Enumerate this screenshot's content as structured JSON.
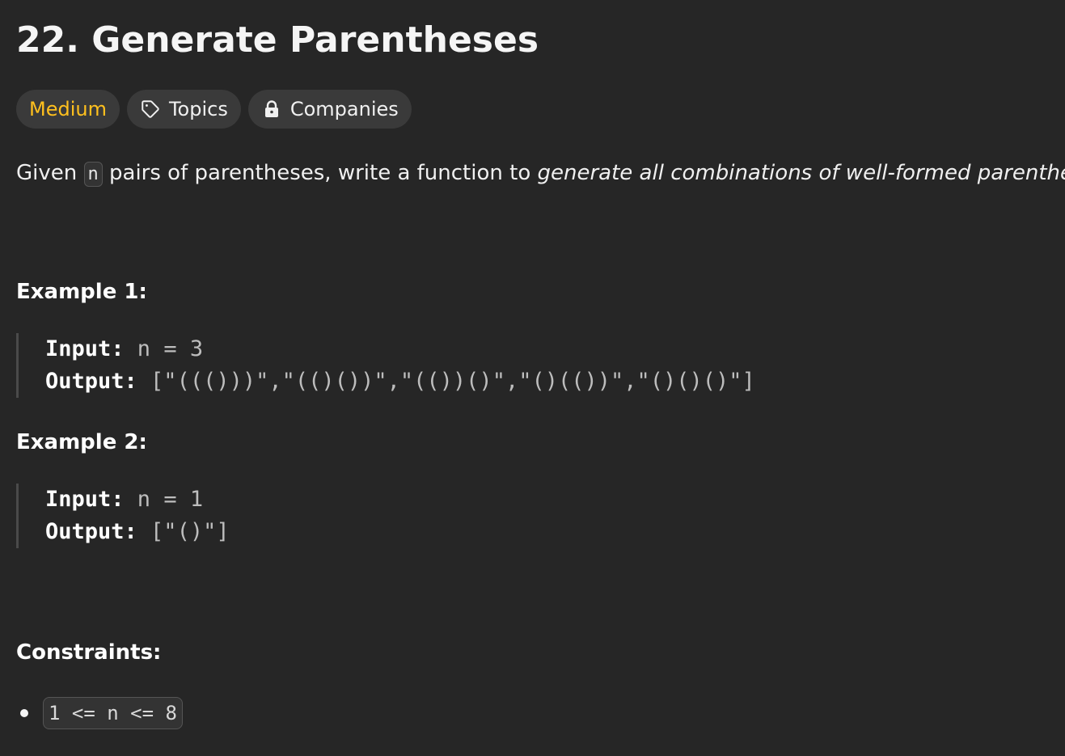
{
  "problem": {
    "title": "22. Generate Parentheses",
    "difficulty": "Medium",
    "topics_label": "Topics",
    "companies_label": "Companies",
    "difficulty_color": "#ffc01e",
    "icons": {
      "topics": "tag-icon",
      "companies": "lock-icon"
    }
  },
  "description": {
    "before": "Given ",
    "code": "n",
    "middle": " pairs of parentheses, write a function to ",
    "emphasis": "generate all combinations of well-formed parentheses",
    "after": "."
  },
  "examples": [
    {
      "heading": "Example 1:",
      "input_label": "Input:",
      "input_value": " n = 3",
      "output_label": "Output:",
      "output_value": " [\"((()))\",\"(()())\",\"(())()\",\"()(())\",\"()()()\"]"
    },
    {
      "heading": "Example 2:",
      "input_label": "Input:",
      "input_value": " n = 1",
      "output_label": "Output:",
      "output_value": " [\"()\"]"
    }
  ],
  "constraints": {
    "heading": "Constraints:",
    "items": [
      "1 <= n <= 8"
    ]
  }
}
